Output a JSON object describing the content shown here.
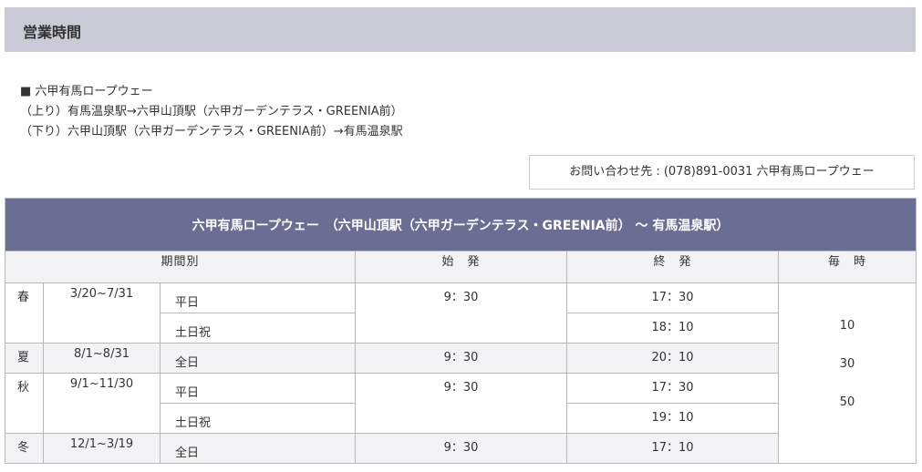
{
  "section": {
    "title": "営業時間"
  },
  "intro": {
    "heading": "■ 六甲有馬ロープウェー",
    "up": "（上り）有馬温泉駅→六甲山頂駅（六甲ガーデンテラス・GREENIA前）",
    "down": "（下り）六甲山頂駅（六甲ガーデンテラス・GREENIA前）→有馬温泉駅"
  },
  "inquiry": "お問い合わせ先 : (078)891-0031 六甲有馬ロープウェー",
  "table": {
    "caption": "六甲有馬ロープウェー　（六甲山頂駅（六甲ガーデンテラス・GREENIA前） ～ 有馬温泉駅）",
    "headers": {
      "period": "期間別",
      "first": "始　発",
      "last": "終　発",
      "every": "毎　時"
    },
    "rows": [
      {
        "season": "春",
        "period": "3/20~7/31",
        "type": "平日",
        "first": "9：30",
        "last": "17：30"
      },
      {
        "type": "土日祝",
        "last": "18：10"
      },
      {
        "season": "夏",
        "period": "8/1~8/31",
        "type": "全日",
        "first": "9：30",
        "last": "20：10"
      },
      {
        "season": "秋",
        "period": "9/1~11/30",
        "type": "平日",
        "first": "9：30",
        "last": "17：30"
      },
      {
        "type": "土日祝",
        "last": "19：10"
      },
      {
        "season": "冬",
        "period": "12/1~3/19",
        "type": "全日",
        "first": "9：30",
        "last": "17：10"
      }
    ],
    "every": [
      "10",
      "30",
      "50"
    ]
  },
  "colors": {
    "header_bg": "#c9cad6",
    "caption_bg": "#6b6e93",
    "row_alt": "#f3f3f6"
  }
}
